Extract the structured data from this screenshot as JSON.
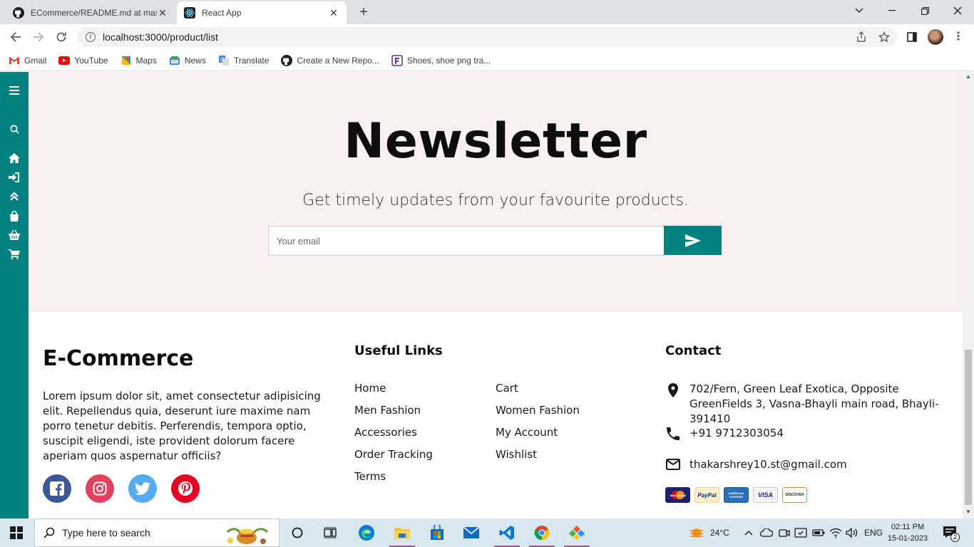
{
  "browser": {
    "tabs": [
      {
        "title": "ECommerce/README.md at master",
        "active": false
      },
      {
        "title": "React App",
        "active": true
      }
    ],
    "url": "localhost:3000/product/list",
    "bookmarks": [
      "Gmail",
      "YouTube",
      "Maps",
      "News",
      "Translate",
      "Create a New Repo...",
      "Shoes, shoe png tra..."
    ]
  },
  "sidebar": {
    "icons": [
      "menu-icon",
      "search-icon",
      "home-icon",
      "login-icon",
      "upgrade-icon",
      "shopping-bag-icon",
      "basket-icon",
      "cart-icon"
    ]
  },
  "newsletter": {
    "title": "Newsletter",
    "subtitle": "Get timely updates from your favourite products.",
    "email_placeholder": "Your email"
  },
  "footer": {
    "brand": "E-Commerce",
    "about": "Lorem ipsum dolor sit, amet consectetur adipisicing elit. Repellendus quia, deserunt iure maxime nam porro tenetur debitis. Perferendis, tempora optio, suscipit eligendi, iste provident dolorum facere aperiam quos aspernatur officiis?",
    "useful_links_title": "Useful Links",
    "links_col1": [
      "Home",
      "Men Fashion",
      "Accessories",
      "Order Tracking",
      "Terms"
    ],
    "links_col2": [
      "Cart",
      "Women Fashion",
      "My Account",
      "Wishlist"
    ],
    "contact_title": "Contact",
    "address": "702/Fern, Green Leaf Exotica, Opposite GreenFields 3, Vasna-Bhayli main road, Bhayli-391410",
    "phone": "+91 9712303054",
    "email": "thakarshrey10.st@gmail.com",
    "payment_methods": [
      "MasterCard",
      "PayPal",
      "AMERICAN EXPRESS",
      "VISA",
      "DISCOVER"
    ]
  },
  "colors": {
    "accent": "#008080",
    "newsletter_bg": "#f8f1f0",
    "facebook": "#3b5998",
    "instagram": "#e4405f",
    "twitter": "#55acee",
    "pinterest": "#e60023"
  },
  "taskbar": {
    "search_placeholder": "Type here to search",
    "weather": "24°C",
    "language": "ENG",
    "time": "02:11 PM",
    "date": "15-01-2023",
    "notifications": "2"
  }
}
